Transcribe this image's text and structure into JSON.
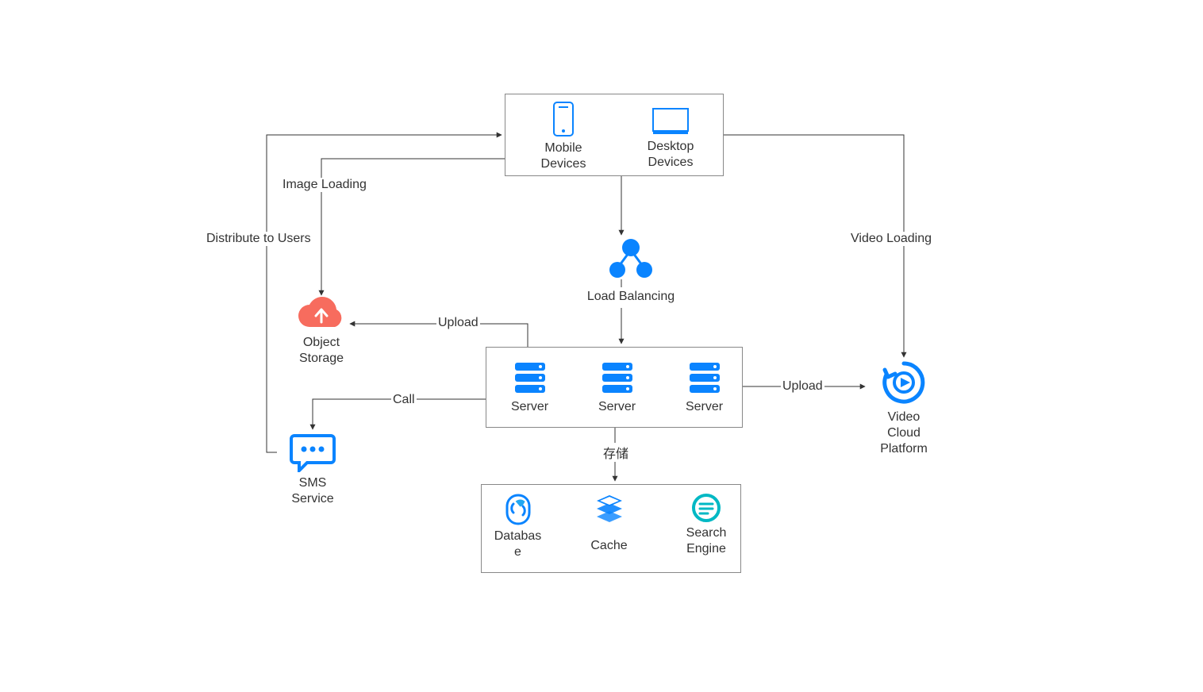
{
  "nodes": {
    "mobile": {
      "label": "Mobile\nDevices"
    },
    "desktop": {
      "label": "Desktop\nDevices"
    },
    "loadBalancing": {
      "label": "Load Balancing"
    },
    "server1": {
      "label": "Server"
    },
    "server2": {
      "label": "Server"
    },
    "server3": {
      "label": "Server"
    },
    "objectStorage": {
      "label": "Object\nStorage"
    },
    "sms": {
      "label": "SMS\nService"
    },
    "videoCloud": {
      "label": "Video\nCloud\nPlatform"
    },
    "database": {
      "label": "Databas\ne"
    },
    "cache": {
      "label": "Cache"
    },
    "searchEngine": {
      "label": "Search\nEngine"
    }
  },
  "edges": {
    "distribute": "Distribute to Users",
    "imageLoading": "Image Loading",
    "upload1": "Upload",
    "call": "Call",
    "storage": "存储",
    "upload2": "Upload",
    "videoLoading": "Video Loading"
  }
}
